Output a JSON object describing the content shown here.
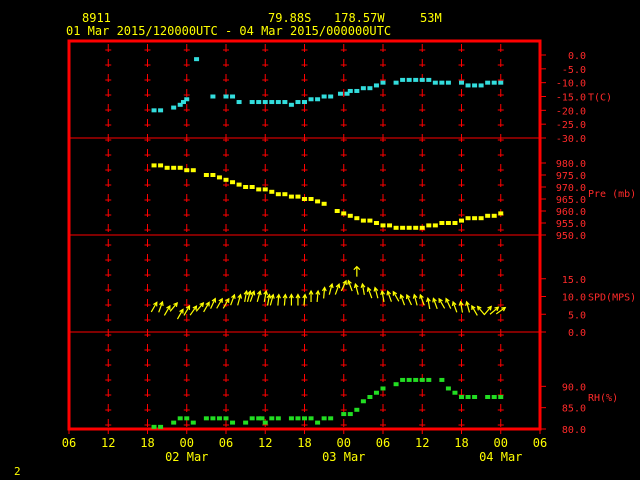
{
  "header": {
    "station": "8911",
    "lat": "79.88S",
    "lon": "178.57W",
    "elev": "53M",
    "time_range": "01 Mar 2015/120000UTC - 04 Mar 2015/000000UTC"
  },
  "footer": {
    "page": "2"
  },
  "colors": {
    "frame": "#ff0000",
    "text": "#ffff00",
    "temp": "#33dddd",
    "pres": "#ffff00",
    "wind": "#ffff00",
    "rh": "#22dd22"
  },
  "x_axis": {
    "hour_ticks": [
      "06",
      "12",
      "18",
      "00",
      "06",
      "12",
      "18",
      "00",
      "06",
      "12",
      "18",
      "00",
      "06"
    ],
    "date_labels": [
      {
        "text": "02 Mar",
        "hour": 18
      },
      {
        "text": "03 Mar",
        "hour": 42
      },
      {
        "text": "04 Mar",
        "hour": 66
      }
    ]
  },
  "chart_data": [
    {
      "type": "scatter",
      "ylabel": "T(C)",
      "ylim": [
        -30,
        0
      ],
      "yticks": [
        "0.0",
        "-5.0",
        "-10.0",
        "-15.0",
        "-20.0",
        "-25.0",
        "-30.0"
      ],
      "color": "#33dddd",
      "x": [
        13,
        14,
        16,
        17,
        17.5,
        18,
        19.5,
        22,
        24,
        25,
        26,
        28,
        29,
        30,
        31,
        32,
        33,
        34,
        35,
        36,
        37,
        38,
        39,
        40,
        41.5,
        42.5,
        43,
        44,
        45,
        46,
        47,
        48,
        50,
        51,
        52,
        53,
        54,
        55,
        56,
        57,
        58,
        60,
        61,
        62,
        63,
        64,
        65,
        66
      ],
      "y": [
        -20,
        -20,
        -19,
        -18,
        -17,
        -16,
        -1.5,
        -15,
        -15,
        -15,
        -17,
        -17,
        -17,
        -17,
        -17,
        -17,
        -17,
        -18,
        -17,
        -17,
        -16,
        -16,
        -15,
        -15,
        -14,
        -14,
        -13,
        -13,
        -12,
        -12,
        -11,
        -10,
        -10,
        -9,
        -9,
        -9,
        -9,
        -9,
        -10,
        -10,
        -10,
        -10,
        -11,
        -11,
        -11,
        -10,
        -10,
        -10
      ]
    },
    {
      "type": "scatter",
      "ylabel": "Pre (mb)",
      "ylim": [
        950,
        985
      ],
      "yticks": [
        "980.0",
        "975.0",
        "970.0",
        "965.0",
        "960.0",
        "955.0",
        "950.0"
      ],
      "color": "#ffff00",
      "x": [
        13,
        14,
        15,
        16,
        17,
        18,
        19,
        21,
        22,
        23,
        24,
        25,
        26,
        27,
        28,
        29,
        30,
        31,
        32,
        33,
        34,
        35,
        36,
        37,
        38,
        39,
        41,
        42,
        43,
        44,
        45,
        46,
        47,
        48,
        49,
        50,
        51,
        52,
        53,
        54,
        55,
        56,
        57,
        58,
        59,
        60,
        61,
        62,
        63,
        64,
        65,
        66
      ],
      "y": [
        979,
        979,
        978,
        978,
        978,
        977,
        977,
        975,
        975,
        974,
        973,
        972,
        971,
        970,
        970,
        969,
        969,
        968,
        967,
        967,
        966,
        966,
        965,
        965,
        964,
        963,
        960,
        959,
        958,
        957,
        956,
        956,
        955,
        954,
        954,
        953,
        953,
        953,
        953,
        953,
        954,
        954,
        955,
        955,
        955,
        956,
        957,
        957,
        957,
        958,
        958,
        959
      ]
    },
    {
      "type": "scatter",
      "ylabel": "SPD(MPS)",
      "ylim": [
        0,
        20
      ],
      "yticks": [
        "15.0",
        "10.0",
        "5.0",
        "0.0"
      ],
      "color": "#ffff00",
      "x": [
        13,
        14,
        15,
        16,
        17,
        18,
        19,
        20,
        21,
        22,
        23,
        24,
        25,
        26,
        27,
        27.5,
        28,
        29,
        30,
        30.5,
        31,
        32,
        33,
        34,
        35,
        36,
        37,
        38,
        39,
        40,
        41,
        42,
        43,
        44,
        45,
        46,
        47,
        48,
        49,
        50,
        51,
        52,
        53,
        54,
        55,
        56,
        57,
        58,
        59,
        60,
        61,
        62,
        63,
        64,
        65,
        66
      ],
      "y": [
        7,
        7,
        6,
        7,
        5,
        6,
        6,
        7,
        7,
        8,
        8,
        8,
        9,
        9,
        10,
        10,
        10,
        10,
        10,
        9,
        9,
        9,
        9,
        9,
        9,
        9,
        10,
        10,
        11,
        12,
        12,
        13,
        13,
        12,
        12,
        11,
        11,
        10,
        10,
        10,
        9,
        9,
        9,
        9,
        8,
        8,
        8,
        8,
        7,
        7,
        7,
        6,
        6,
        6,
        6,
        6
      ],
      "dir_deg": [
        30,
        20,
        30,
        40,
        30,
        30,
        35,
        40,
        30,
        25,
        30,
        30,
        20,
        15,
        10,
        15,
        20,
        15,
        10,
        10,
        15,
        5,
        5,
        0,
        0,
        5,
        0,
        5,
        5,
        15,
        20,
        25,
        340,
        345,
        350,
        340,
        345,
        350,
        340,
        330,
        340,
        335,
        345,
        340,
        350,
        340,
        330,
        335,
        340,
        350,
        345,
        330,
        320,
        40,
        50,
        55
      ],
      "isolated_arrow": {
        "x": 44,
        "y": 17
      }
    },
    {
      "type": "scatter",
      "ylabel": "RH(%)",
      "ylim": [
        80,
        95
      ],
      "yticks": [
        "90.0",
        "85.0",
        "80.0"
      ],
      "color": "#22dd22",
      "x": [
        13,
        14,
        16,
        17,
        18,
        19,
        21,
        22,
        23,
        24,
        25,
        27,
        28,
        29,
        29.5,
        30,
        31,
        32,
        34,
        35,
        36,
        37,
        38,
        39,
        40,
        42,
        43,
        44,
        45,
        46,
        47,
        48,
        50,
        51,
        52,
        53,
        54,
        55,
        57,
        58,
        59,
        60,
        61,
        62,
        64,
        65,
        66
      ],
      "y": [
        80.5,
        80.5,
        81.5,
        82.5,
        82.5,
        81.5,
        82.5,
        82.5,
        82.5,
        82.5,
        81.5,
        81.5,
        82.5,
        82.5,
        82.5,
        81.5,
        82.5,
        82.5,
        82.5,
        82.5,
        82.5,
        82.5,
        81.5,
        82.5,
        82.5,
        83.5,
        83.5,
        84.5,
        86.5,
        87.5,
        88.5,
        89.5,
        90.5,
        91.5,
        91.5,
        91.5,
        91.5,
        91.5,
        91.5,
        89.5,
        88.5,
        87.5,
        87.5,
        87.5,
        87.5,
        87.5,
        87.5
      ]
    }
  ]
}
